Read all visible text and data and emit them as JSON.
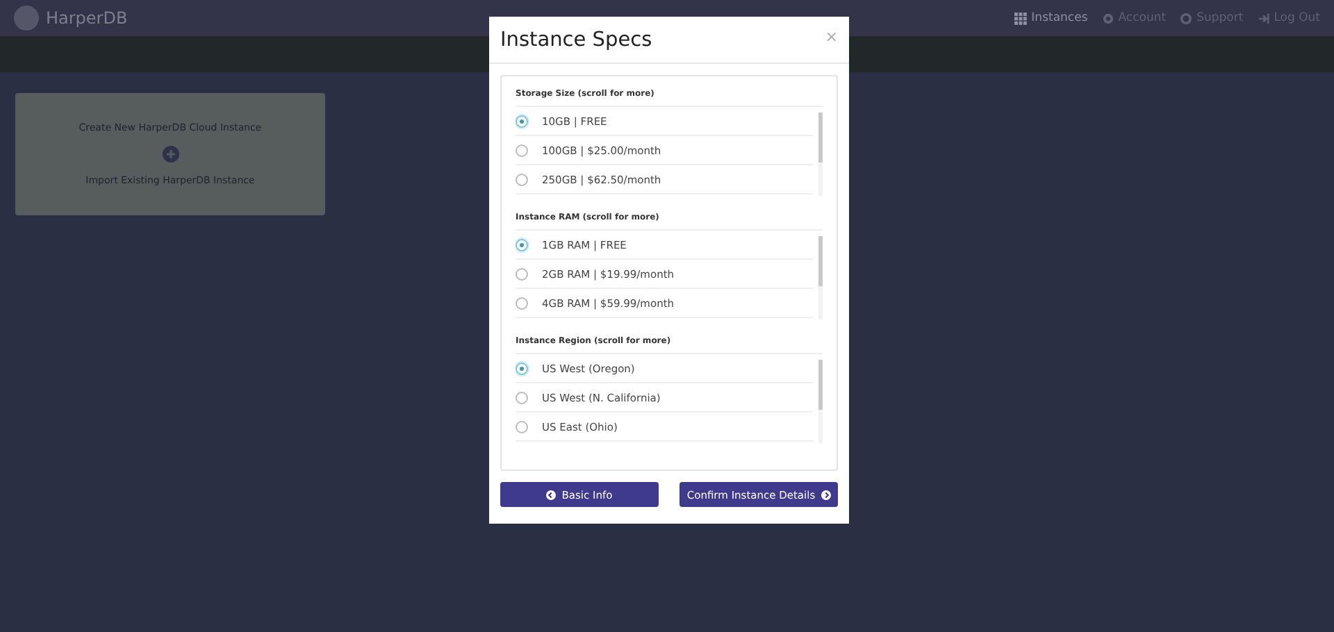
{
  "header": {
    "logo": "HarperDB",
    "nav": [
      {
        "label": "Instances",
        "kind": "grid",
        "selected": true
      },
      {
        "label": "Account",
        "kind": "gear",
        "selected": false
      },
      {
        "label": "Support",
        "kind": "lifebuoy",
        "selected": false
      },
      {
        "label": "Log Out",
        "kind": "signout",
        "selected": false
      }
    ]
  },
  "card": {
    "create_label": "Create New HarperDB Cloud Instance",
    "import_label": "Import Existing HarperDB Instance"
  },
  "modal": {
    "title": "Instance Specs",
    "close": "×",
    "sections": [
      {
        "label": "Storage Size (scroll for more)",
        "options": [
          {
            "label": "10GB | FREE",
            "selected": true
          },
          {
            "label": "100GB | $25.00/month",
            "selected": false
          },
          {
            "label": "250GB | $62.50/month",
            "selected": false
          }
        ]
      },
      {
        "label": "Instance RAM (scroll for more)",
        "options": [
          {
            "label": "1GB RAM | FREE",
            "selected": true
          },
          {
            "label": "2GB RAM | $19.99/month",
            "selected": false
          },
          {
            "label": "4GB RAM | $59.99/month",
            "selected": false
          }
        ]
      },
      {
        "label": "Instance Region (scroll for more)",
        "options": [
          {
            "label": "US West (Oregon)",
            "selected": true
          },
          {
            "label": "US West (N. California)",
            "selected": false
          },
          {
            "label": "US East (Ohio)",
            "selected": false
          }
        ]
      }
    ],
    "buttons": [
      {
        "label": "Basic Info",
        "kind": "back"
      },
      {
        "label": "Confirm Instance Details",
        "kind": "next"
      }
    ]
  }
}
